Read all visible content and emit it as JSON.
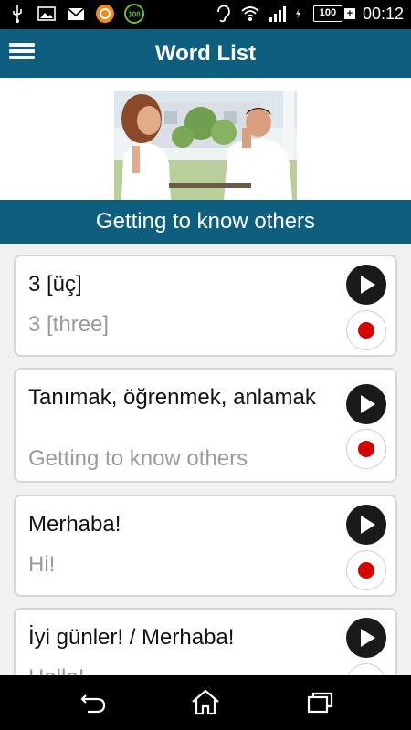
{
  "status_bar": {
    "time": "00:12",
    "battery_level": "100",
    "left_icons": [
      "usb-icon",
      "image-icon",
      "mail-icon",
      "app-orange-icon",
      "app-green-100-icon"
    ],
    "right_icons": [
      "hearing-aid-icon",
      "wifi-icon",
      "signal-icon",
      "charging-icon",
      "battery-icon"
    ]
  },
  "app_bar": {
    "title": "Word List"
  },
  "section": {
    "title": "Getting to know others"
  },
  "cards": [
    {
      "main": "3 [üç]",
      "sub": "3 [three]"
    },
    {
      "main": "Tanımak, öğrenmek, anlamak",
      "sub": "Getting to know others"
    },
    {
      "main": "Merhaba!",
      "sub": "Hi!"
    },
    {
      "main": "İyi günler! / Merhaba!",
      "sub": "Hello!"
    }
  ],
  "colors": {
    "primary": "#0e5e80",
    "record": "#d60000",
    "play": "#1a1a1a"
  },
  "nav_bar": {
    "icons": [
      "back-icon",
      "home-icon",
      "recents-icon"
    ]
  }
}
